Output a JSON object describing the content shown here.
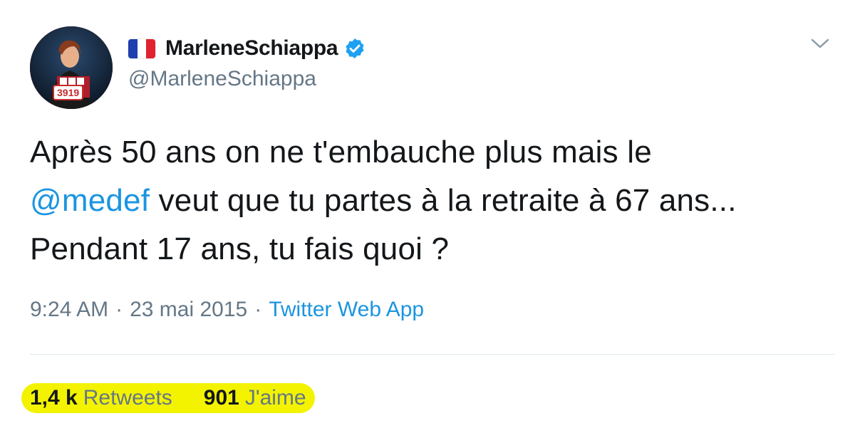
{
  "user": {
    "display_name": "MarleneSchiappa",
    "handle": "@MarleneSchiappa",
    "verified": true,
    "flag_icon": "france-flag-icon",
    "avatar_badge_text": "3919"
  },
  "tweet": {
    "text_before_mention": "Après 50 ans on ne t'embauche plus mais le",
    "mention": "@medef",
    "text_after_mention": " veut que tu partes à la retraite à 67 ans... Pendant 17 ans, tu fais quoi ?"
  },
  "meta": {
    "time": "9:24 AM",
    "separator": "·",
    "date": "23 mai 2015",
    "source": "Twitter Web App"
  },
  "stats": {
    "retweets_value": "1,4 k",
    "retweets_label": "Retweets",
    "likes_value": "901",
    "likes_label": "J'aime"
  },
  "colors": {
    "link": "#1b95e0",
    "secondary_text": "#657786",
    "highlight": "#f3f300",
    "verified_badge": "#1da1f2",
    "flag_blue": "#1f3fb0",
    "flag_white": "#ffffff",
    "flag_red": "#e0232f"
  }
}
